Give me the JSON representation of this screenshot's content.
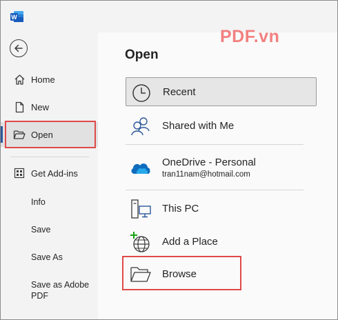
{
  "colors": {
    "accent": "#2b579a",
    "highlight_box": "#e04848",
    "onedrive": "#0f6cbd",
    "add_place_plus": "#13a10e",
    "watermark": "#f26b6b"
  },
  "watermark": "PDF.vn",
  "sidebar": {
    "logo_icon": "word-logo",
    "back_icon": "back-arrow-icon",
    "items": [
      {
        "label": "Home",
        "icon": "home-icon"
      },
      {
        "label": "New",
        "icon": "new-document-icon"
      },
      {
        "label": "Open",
        "icon": "folder-open-icon",
        "selected": true
      },
      {
        "label": "Get Add-ins",
        "icon": "add-ins-icon"
      }
    ],
    "text_items": [
      "Info",
      "Save",
      "Save As",
      "Save as Adobe PDF"
    ]
  },
  "main": {
    "title": "Open",
    "options": [
      {
        "label": "Recent",
        "icon": "clock-icon",
        "selected": true
      },
      {
        "label": "Shared with Me",
        "icon": "people-icon"
      },
      {
        "label": "OneDrive - Personal",
        "sublabel": "tran11nam@hotmail.com",
        "icon": "onedrive-cloud-icon"
      },
      {
        "label": "This PC",
        "icon": "computer-icon"
      },
      {
        "label": "Add a Place",
        "icon": "add-globe-icon"
      },
      {
        "label": "Browse",
        "icon": "folder-browse-icon"
      }
    ]
  }
}
